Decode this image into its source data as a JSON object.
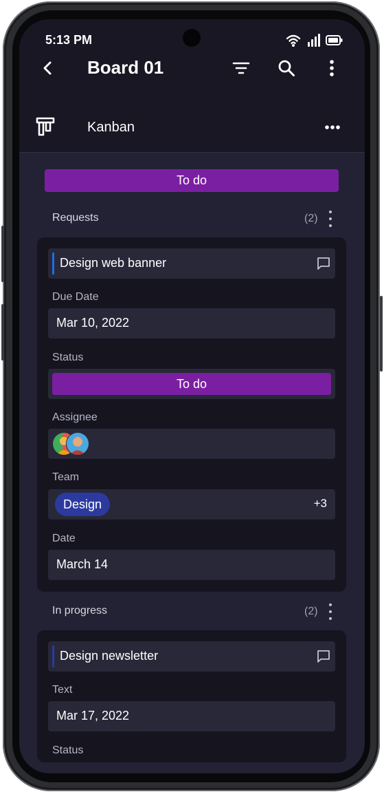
{
  "status_bar": {
    "time": "5:13 PM"
  },
  "header": {
    "title": "Board 01"
  },
  "view": {
    "label": "Kanban"
  },
  "column": {
    "title": "To do"
  },
  "groups": [
    {
      "title": "Requests",
      "count": "(2)"
    },
    {
      "title": "In progress",
      "count": "(2)"
    }
  ],
  "card1": {
    "title": "Design web banner",
    "accent_color": "#1e6ee8",
    "due_date_label": "Due Date",
    "due_date_value": "Mar 10, 2022",
    "status_label": "Status",
    "status_value": "To do",
    "assignee_label": "Assignee",
    "team_label": "Team",
    "team_value": "Design",
    "team_extra": "+3",
    "date_label": "Date",
    "date_value": "March 14"
  },
  "card2": {
    "title": "Design newsletter",
    "accent_color": "#2c3aa0",
    "text_label": "Text",
    "text_value": "Mar 17, 2022",
    "status_label": "Status"
  },
  "colors": {
    "status_todo": "#7b1fa2",
    "team_chip": "#2c3aa0",
    "background": "#232234",
    "header_bg": "#181723",
    "card_bg": "#15141f"
  }
}
